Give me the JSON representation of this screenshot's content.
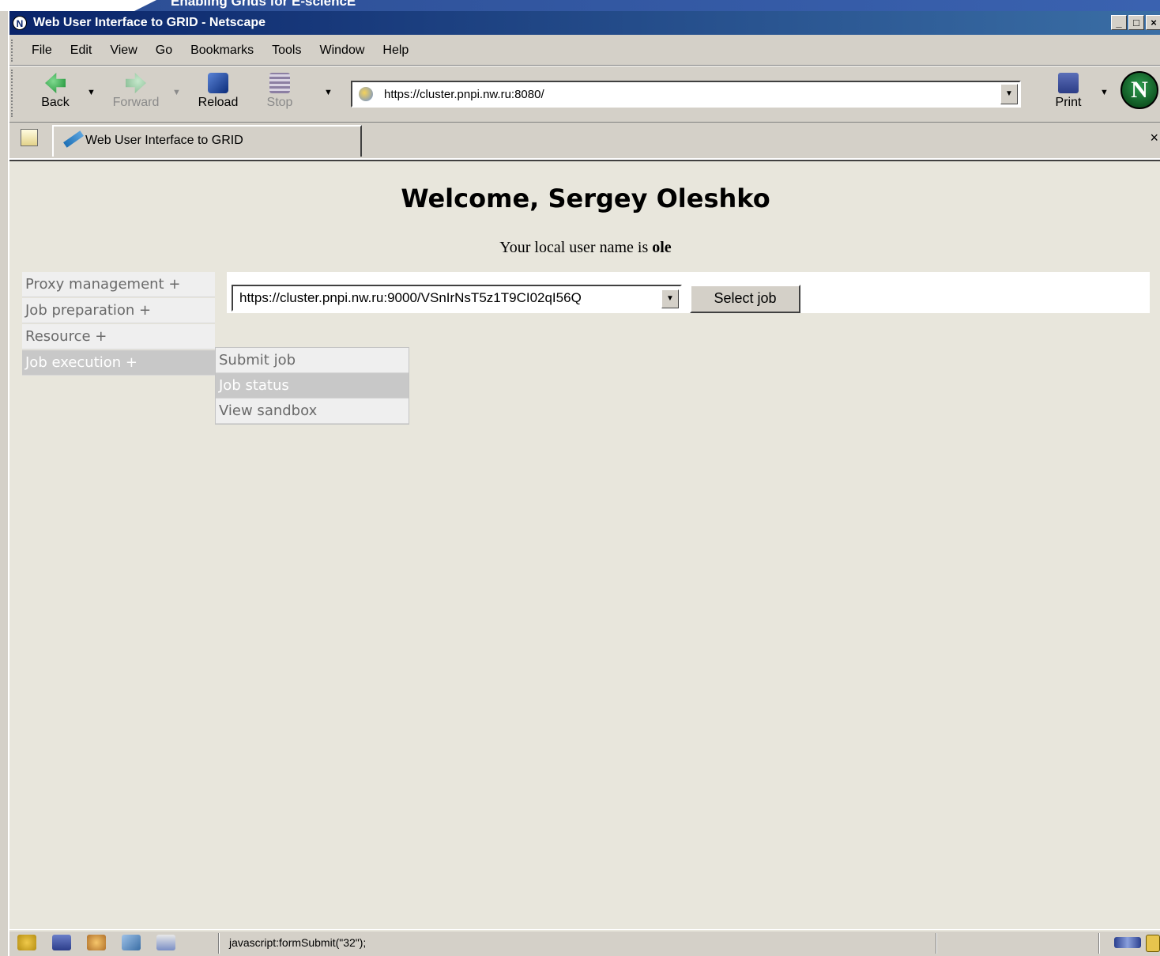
{
  "banner": {
    "text": "Enabling Grids for E-sciencE"
  },
  "window": {
    "title": "Web User Interface to GRID - Netscape",
    "controls": {
      "minimize": "_",
      "maximize": "□",
      "close": "×"
    }
  },
  "menubar": {
    "items": [
      "File",
      "Edit",
      "View",
      "Go",
      "Bookmarks",
      "Tools",
      "Window",
      "Help"
    ]
  },
  "navbar": {
    "back": "Back",
    "forward": "Forward",
    "reload": "Reload",
    "stop": "Stop",
    "print": "Print",
    "url": "https://cluster.pnpi.nw.ru:8080/",
    "dropdown_glyph": "▼",
    "logo": "N"
  },
  "tabs": {
    "items": [
      {
        "label": "Web User Interface to GRID"
      }
    ],
    "close": "×"
  },
  "page": {
    "heading": "Welcome, Sergey Oleshko",
    "local_user_prefix": "Your local user name is ",
    "local_user_name": "ole"
  },
  "sidemenu": {
    "items": [
      {
        "label": "Proxy management +",
        "active": false
      },
      {
        "label": "Job preparation +",
        "active": false
      },
      {
        "label": "Resource +",
        "active": false
      },
      {
        "label": "Job execution +",
        "active": true
      }
    ]
  },
  "submenu": {
    "items": [
      {
        "label": "Submit job",
        "active": false
      },
      {
        "label": "Job status",
        "active": true
      },
      {
        "label": "View sandbox",
        "active": false
      }
    ]
  },
  "form": {
    "job_select_value": "https://cluster.pnpi.nw.ru:9000/VSnIrNsT5z1T9CI02qI56Q",
    "select_button": "Select job"
  },
  "statusbar": {
    "text": "javascript:formSubmit(\"32\");"
  },
  "colors": {
    "titlebar_start": "#0a246a",
    "titlebar_end": "#3a6ea5",
    "content_bg": "#e8e6dc",
    "menu_active_bg": "#c8c8c8",
    "menu_bg": "#efefef"
  }
}
